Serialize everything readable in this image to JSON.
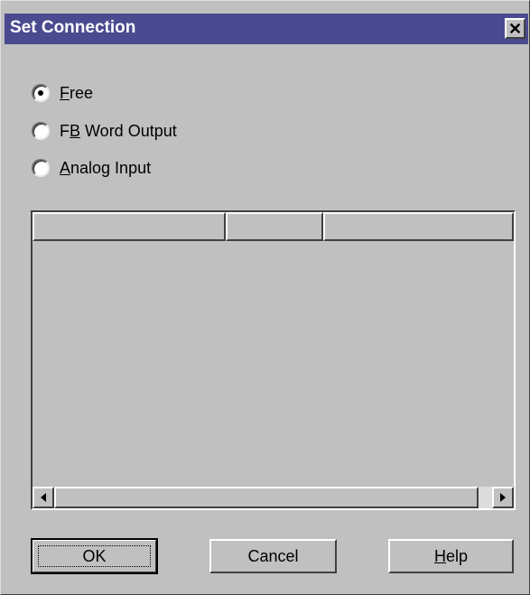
{
  "dialog": {
    "title": "Set Connection",
    "close_glyph": "✕",
    "close_icon": "close-icon"
  },
  "radios": [
    {
      "label_pre": "",
      "label_ul": "F",
      "label_post": "ree",
      "selected": true
    },
    {
      "label_pre": "F",
      "label_ul": "B",
      "label_post": " Word Output",
      "selected": false
    },
    {
      "label_pre": "",
      "label_ul": "A",
      "label_post": "nalog Input",
      "selected": false
    }
  ],
  "listview": {
    "columns": [
      "",
      "",
      ""
    ],
    "rows": []
  },
  "scrollbar": {
    "left_icon": "arrow-left-icon",
    "right_icon": "arrow-right-icon"
  },
  "buttons": {
    "ok": "OK",
    "cancel": "Cancel",
    "help_ul": "H",
    "help_post": "elp"
  },
  "colors": {
    "titlebar": "#4a4a90",
    "face": "#c0c0c0"
  }
}
